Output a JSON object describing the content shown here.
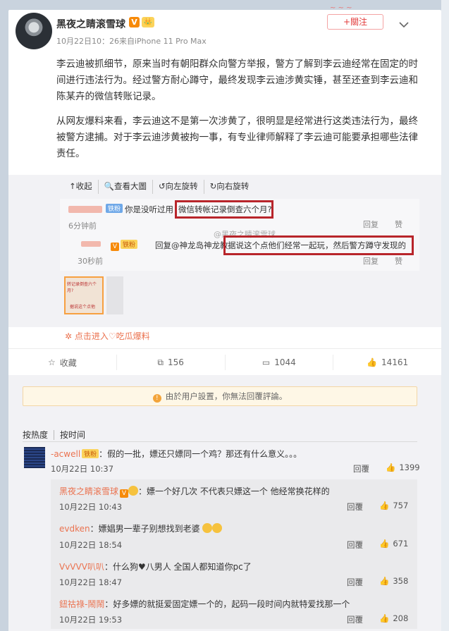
{
  "post": {
    "username": "黑夜之睛滚雪球",
    "vbadge": "V",
    "fanbadge": "👑",
    "meta": "10月22日10：26来自iPhone 11 Pro Max",
    "follow": "+關注",
    "paragraph1": "李云迪被抓细节，原来当时有朝阳群众向警方举报，警方了解到李云迪经常在固定的时间进行违法行为。经过警方耐心蹲守，最终发现李云迪涉黄实锤，甚至还查到李云迪和陈某卉的微信转账记录。",
    "paragraph2": "从网友爆料来看，李云迪这不是第一次涉黄了，很明显是经常进行这类违法行为，最终被警方逮捕。对于李云迪涉黄被拘一事，有专业律师解释了李云迪可能要承担哪些法律责任。"
  },
  "toolbar": {
    "collapse": "↑收起",
    "view_large": "查看大圖",
    "rotate_left": "向左旋转",
    "rotate_right": "向右旋转"
  },
  "image": {
    "line1_tag": "铁粉",
    "line1_text": "你是没听过用",
    "line1_boxed": "微信转帐记录倒查六个月?",
    "line1_time": "6分钟前",
    "line1_reply": "回复",
    "line1_like": "赞",
    "watermark": "@黑夜之睛滚雪球",
    "line2_text": "回复@神龙岛神龙教",
    "line2_boxed": "据说这个点他们经常一起玩，然后警方蹲守发现的",
    "line2_time": "30秒前",
    "line2_reply": "回复",
    "line2_like": "赞",
    "thumb_text1": "转记录倒查六个月?",
    "thumb_text2": "据说这个点他"
  },
  "entry": "点击进入♡吃瓜爆料",
  "actions": {
    "favorite": "收藏",
    "repost": "156",
    "comment": "1044",
    "like": "14161"
  },
  "notice": "由於用户設置，你無法回覆評論。",
  "sort": {
    "hot": "按热度",
    "time": "按时间"
  },
  "comments": [
    {
      "name": "-acwell",
      "badge": "铁粉",
      "text": "：假的一批，嫖还只嫖同一个鸡？那还有什么意义。。。",
      "time": "10月22日 10:37",
      "reply": "回覆",
      "likes": "1399"
    }
  ],
  "replies": [
    {
      "name": "黑夜之睛滚雪球",
      "text": "：嫖一个好几次  不代表只嫖这一个  他经常换花样的",
      "time": "10月22日 10:43",
      "reply": "回覆",
      "likes": "757"
    },
    {
      "name": "evdken",
      "text": "：嫖娼男一辈子别想找到老婆",
      "time": "10月22日 18:54",
      "reply": "回覆",
      "likes": "671"
    },
    {
      "name": "VvVVV叭叭",
      "text": "：什么狗♥八男人 全国人都知道你pc了",
      "time": "10月22日 18:47",
      "reply": "回覆",
      "likes": "358"
    },
    {
      "name": "鈕祜祿-鬧鬧",
      "text": "：好多嫖的就挺爱固定嫖一个的，起码一段时间内就特爱找那一个",
      "time": "10月22日 19:53",
      "reply": "回覆",
      "likes": "208"
    }
  ]
}
